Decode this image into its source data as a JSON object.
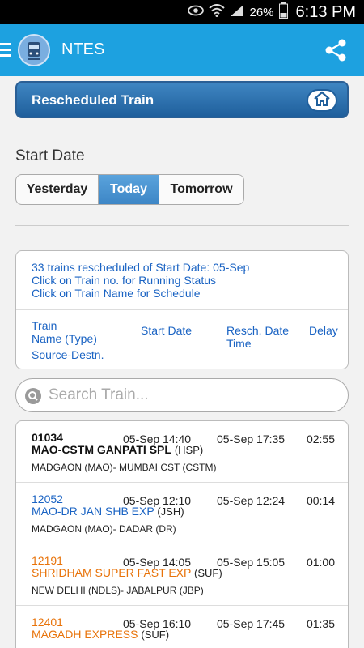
{
  "status_bar": {
    "battery": "26%",
    "time": "6:13 PM"
  },
  "app": {
    "title": "NTES"
  },
  "banner": {
    "title": "Rescheduled Train"
  },
  "start_date": {
    "label": "Start Date",
    "options": [
      "Yesterday",
      "Today",
      "Tomorrow"
    ],
    "selected": "Today"
  },
  "info": {
    "lines": [
      "33 trains rescheduled of Start Date: 05-Sep",
      "Click on Train no. for Running Status",
      "Click on Train Name for Schedule"
    ],
    "columns": {
      "train_line1": "Train",
      "train_line2": "Name (Type)",
      "train_line3": "Source-Destn.",
      "start": "Start Date",
      "resch_line1": "Resch. Date",
      "resch_line2": "Time",
      "delay": "Delay"
    }
  },
  "search": {
    "placeholder": "Search Train..."
  },
  "colors": {
    "black": "#111111",
    "blue": "#1a63c3",
    "orange": "#e8730a",
    "accent": "#1da1e0"
  },
  "trains": [
    {
      "no": "01034",
      "name": "MAO-CSTM GANPATI SPL",
      "type": "(HSP)",
      "route": "MADGAON (MAO)- MUMBAI CST (CSTM)",
      "start": "05-Sep 14:40",
      "resched": "05-Sep 17:35",
      "delay": "02:55",
      "color": "black"
    },
    {
      "no": "12052",
      "name": "MAO-DR JAN SHB EXP",
      "type": "(JSH)",
      "route": "MADGAON (MAO)- DADAR (DR)",
      "start": "05-Sep 12:10",
      "resched": "05-Sep 12:24",
      "delay": "00:14",
      "color": "blue"
    },
    {
      "no": "12191",
      "name": "SHRIDHAM SUPER FAST EXP",
      "type": "(SUF)",
      "route": "NEW DELHI (NDLS)- JABALPUR (JBP)",
      "start": "05-Sep 14:05",
      "resched": "05-Sep 15:05",
      "delay": "01:00",
      "color": "orange"
    },
    {
      "no": "12401",
      "name": "MAGADH EXPRESS",
      "type": "(SUF)",
      "route": "",
      "start": "05-Sep 16:10",
      "resched": "05-Sep 17:45",
      "delay": "01:35",
      "color": "orange"
    }
  ]
}
